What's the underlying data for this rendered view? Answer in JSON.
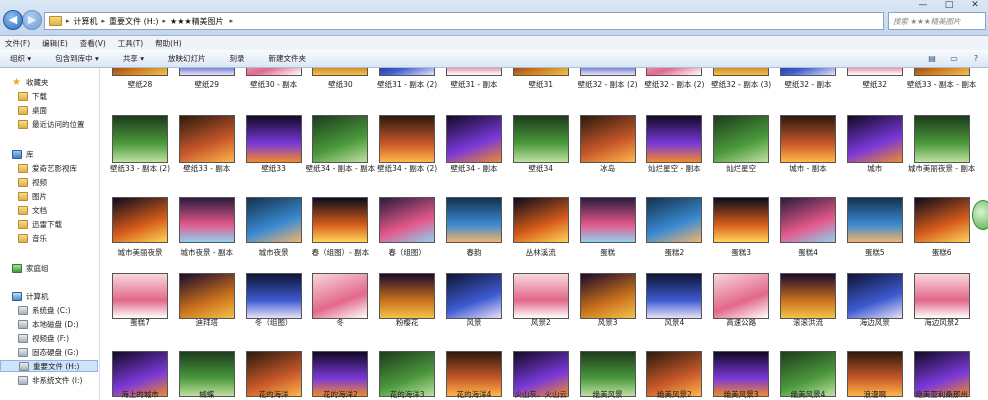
{
  "window": {
    "breadcrumbs": [
      "计算机",
      "重要文件 (H:)",
      "★★★精美图片"
    ],
    "search_placeholder": "搜索 ★★★精美图片",
    "controls": [
      "—",
      "□",
      "✕"
    ]
  },
  "menu": [
    "文件(F)",
    "编辑(E)",
    "查看(V)",
    "工具(T)",
    "帮助(H)"
  ],
  "toolbar": [
    "组织 ▾",
    "包含到库中 ▾",
    "共享 ▾",
    "放映幻灯片",
    "刻录",
    "新建文件夹"
  ],
  "toolbar_right_icons": [
    "view-options-icon",
    "preview-pane-icon",
    "help-icon"
  ],
  "sidebar": {
    "favorites": {
      "title": "收藏夹",
      "items": [
        "下载",
        "桌面",
        "最近访问的位置"
      ]
    },
    "libraries": {
      "title": "库",
      "items": [
        "爱奇艺影视库",
        "视频",
        "图片",
        "文档",
        "迅雷下载",
        "音乐"
      ]
    },
    "homegroup": "家庭组",
    "computer": {
      "title": "计算机",
      "items": [
        "系统盘 (C:)",
        "本地磁盘 (D:)",
        "视频盘 (F:)",
        "固态硬盘 (G:)",
        "重要文件 (H:)",
        "非系统文件 (I:)"
      ]
    }
  },
  "files": [
    [
      "壁纸28",
      "壁纸29",
      "壁纸30 - 副本",
      "壁纸30",
      "壁纸31 - 副本 (2)",
      "壁纸31 - 副本",
      "壁纸31",
      "壁纸32 - 副本 (2)",
      "壁纸32 - 副本 (2)",
      "壁纸32 - 副本 (3)",
      "壁纸32 - 副本",
      "壁纸32",
      "壁纸33 - 副本 - 副本"
    ],
    [
      "壁纸33 - 副本 (2)",
      "壁纸33 - 副本",
      "壁纸33",
      "壁纸34 - 副本 - 副本",
      "壁纸34 - 副本 (2)",
      "壁纸34 - 副本",
      "壁纸34",
      "冰岛",
      "灿烂星空 - 副本",
      "灿烂星空",
      "城市 - 副本",
      "城市",
      "城市美丽夜景 - 副本"
    ],
    [
      "城市美丽夜景",
      "城市夜景 - 副本",
      "城市夜景",
      "春（组图）- 副本",
      "春（组图）",
      "春韵",
      "丛林溪流",
      "蛋糕",
      "蛋糕2",
      "蛋糕3",
      "蛋糕4",
      "蛋糕5",
      "蛋糕6"
    ],
    [
      "蛋糕7",
      "迪拜塔",
      "冬（组图）",
      "冬",
      "粉樱花",
      "风景",
      "风景2",
      "风景3",
      "风景4",
      "高速公路",
      "滚滚洪流",
      "海边风景",
      "海边风景2"
    ],
    [
      "海上的城市",
      "蝴蝶",
      "花的海洋",
      "花的海洋2",
      "花的海洋3",
      "花的海洋4",
      "火山灰、火山云",
      "绝美风景",
      "绝美风景2",
      "绝美风景3",
      "绝美风景4",
      "浪漫啊",
      "绝美亚利桑那州"
    ]
  ],
  "colors": {
    "accent": "#2e6cc0",
    "selection": "#cfe3fb",
    "toolbar_bg": "#dce6f3"
  }
}
